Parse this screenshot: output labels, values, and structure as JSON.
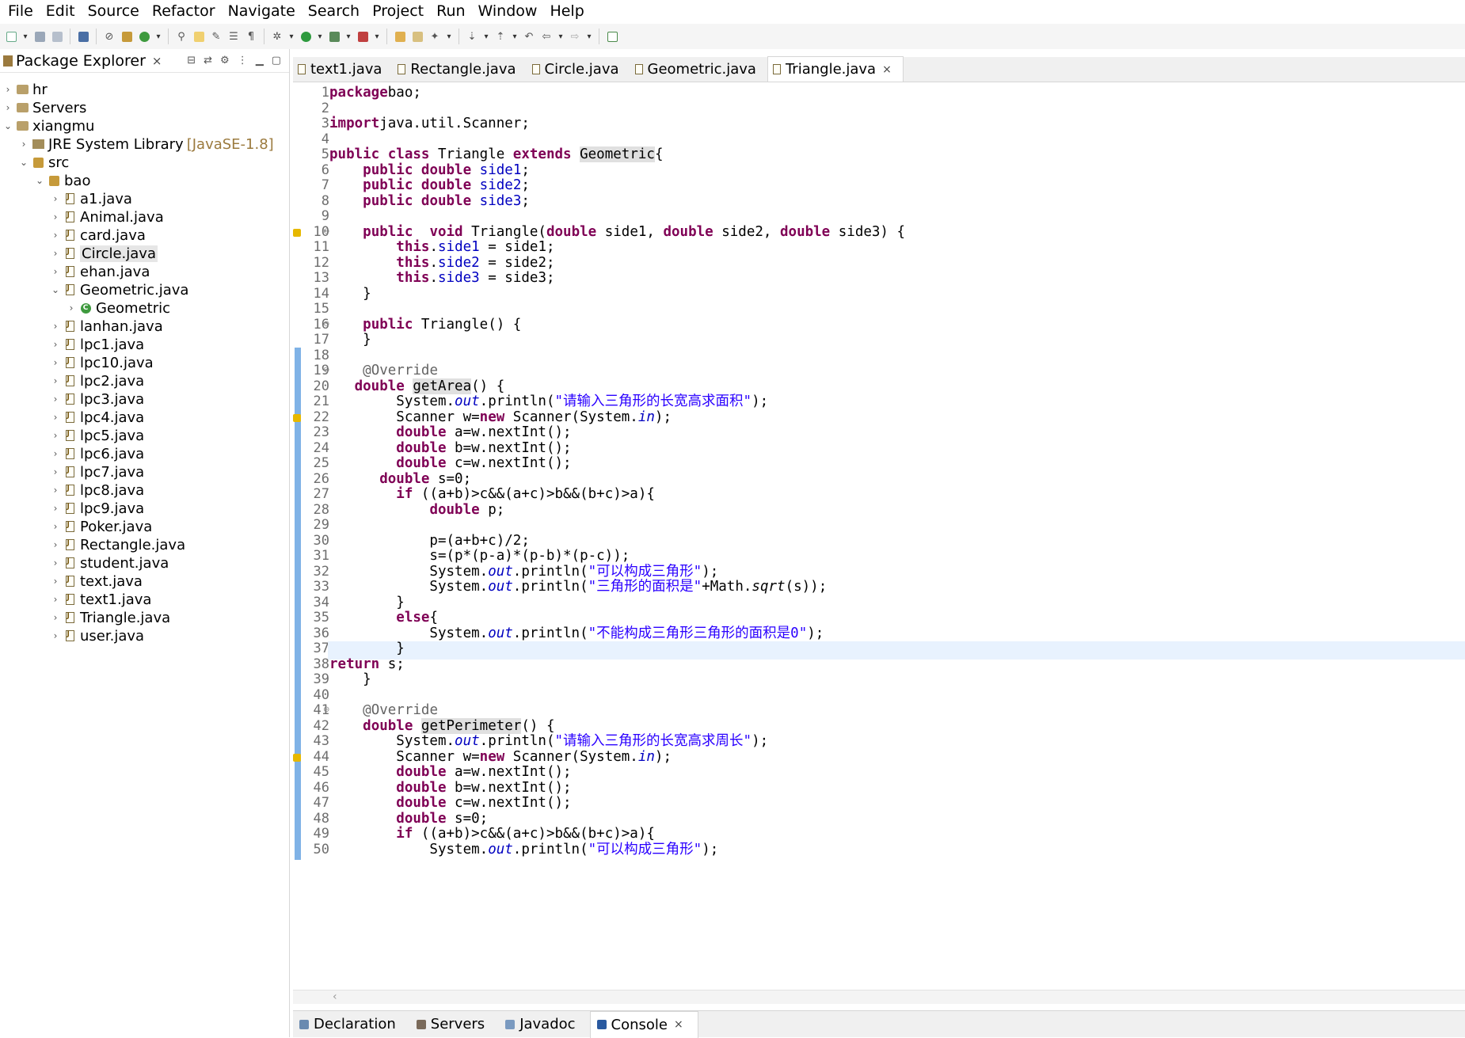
{
  "menu": [
    "File",
    "Edit",
    "Source",
    "Refactor",
    "Navigate",
    "Search",
    "Project",
    "Run",
    "Window",
    "Help"
  ],
  "explorer": {
    "title": "Package Explorer",
    "close": "×",
    "tree": [
      {
        "label": "hr",
        "icon": "project-icon",
        "arrow": "›",
        "indent": 0
      },
      {
        "label": "Servers",
        "icon": "folder-icon",
        "arrow": "›",
        "indent": 0
      },
      {
        "label": "xiangmu",
        "icon": "project-icon",
        "arrow": "⌄",
        "indent": 0
      },
      {
        "label": "JRE System Library",
        "decor": "[JavaSE-1.8]",
        "icon": "library-icon",
        "arrow": "›",
        "indent": 1
      },
      {
        "label": "src",
        "icon": "source-folder-icon",
        "arrow": "⌄",
        "indent": 1
      },
      {
        "label": "bao",
        "icon": "package-icon",
        "arrow": "⌄",
        "indent": 2
      },
      {
        "label": "a1.java",
        "icon": "java-file-icon",
        "arrow": "›",
        "indent": 3
      },
      {
        "label": "Animal.java",
        "icon": "java-file-icon",
        "arrow": "›",
        "indent": 3
      },
      {
        "label": "card.java",
        "icon": "java-file-icon",
        "arrow": "›",
        "indent": 3
      },
      {
        "label": "Circle.java",
        "icon": "java-file-icon",
        "arrow": "›",
        "indent": 3,
        "selected": true
      },
      {
        "label": "ehan.java",
        "icon": "java-file-icon",
        "arrow": "›",
        "indent": 3
      },
      {
        "label": "Geometric.java",
        "icon": "java-file-icon",
        "arrow": "⌄",
        "indent": 3
      },
      {
        "label": "Geometric",
        "icon": "class-icon",
        "arrow": "›",
        "indent": 4
      },
      {
        "label": "lanhan.java",
        "icon": "java-file-icon",
        "arrow": "›",
        "indent": 3
      },
      {
        "label": "lpc1.java",
        "icon": "java-file-icon",
        "arrow": "›",
        "indent": 3
      },
      {
        "label": "lpc10.java",
        "icon": "java-file-icon",
        "arrow": "›",
        "indent": 3
      },
      {
        "label": "lpc2.java",
        "icon": "java-file-icon",
        "arrow": "›",
        "indent": 3
      },
      {
        "label": "lpc3.java",
        "icon": "java-file-icon",
        "arrow": "›",
        "indent": 3
      },
      {
        "label": "lpc4.java",
        "icon": "java-file-icon",
        "arrow": "›",
        "indent": 3
      },
      {
        "label": "lpc5.java",
        "icon": "java-file-icon",
        "arrow": "›",
        "indent": 3
      },
      {
        "label": "lpc6.java",
        "icon": "java-file-icon",
        "arrow": "›",
        "indent": 3
      },
      {
        "label": "lpc7.java",
        "icon": "java-file-icon",
        "arrow": "›",
        "indent": 3
      },
      {
        "label": "lpc8.java",
        "icon": "java-file-icon",
        "arrow": "›",
        "indent": 3
      },
      {
        "label": "lpc9.java",
        "icon": "java-file-icon",
        "arrow": "›",
        "indent": 3
      },
      {
        "label": "Poker.java",
        "icon": "java-file-icon",
        "arrow": "›",
        "indent": 3
      },
      {
        "label": "Rectangle.java",
        "icon": "java-file-icon",
        "arrow": "›",
        "indent": 3
      },
      {
        "label": "student.java",
        "icon": "java-file-icon",
        "arrow": "›",
        "indent": 3
      },
      {
        "label": "text.java",
        "icon": "java-file-icon",
        "arrow": "›",
        "indent": 3
      },
      {
        "label": "text1.java",
        "icon": "java-file-icon",
        "arrow": "›",
        "indent": 3
      },
      {
        "label": "Triangle.java",
        "icon": "java-file-icon",
        "arrow": "›",
        "indent": 3
      },
      {
        "label": "user.java",
        "icon": "java-file-icon",
        "arrow": "›",
        "indent": 3
      }
    ]
  },
  "tabs": [
    {
      "label": "text1.java",
      "active": false
    },
    {
      "label": "Rectangle.java",
      "active": false
    },
    {
      "label": "Circle.java",
      "active": false
    },
    {
      "label": "Geometric.java",
      "active": false
    },
    {
      "label": "Triangle.java",
      "active": true,
      "close": "×"
    }
  ],
  "code": [
    [
      [
        "kw",
        "package"
      ],
      [
        "",
        "bao;"
      ]
    ],
    [],
    [
      [
        "kw",
        "import"
      ],
      [
        "",
        "java.util.Scanner;"
      ]
    ],
    [],
    [
      [
        "kw",
        "public class"
      ],
      [
        "",
        " Triangle "
      ],
      [
        "kw",
        "extends"
      ],
      [
        "",
        " "
      ],
      [
        "hl",
        "Geometric"
      ],
      [
        "",
        "{"
      ]
    ],
    [
      [
        "",
        "    "
      ],
      [
        "kw",
        "public double"
      ],
      [
        "",
        " "
      ],
      [
        "fld",
        "side1"
      ],
      [
        "",
        ";"
      ]
    ],
    [
      [
        "",
        "    "
      ],
      [
        "kw",
        "public double"
      ],
      [
        "",
        " "
      ],
      [
        "fld",
        "side2"
      ],
      [
        "",
        ";"
      ]
    ],
    [
      [
        "",
        "    "
      ],
      [
        "kw",
        "public double"
      ],
      [
        "",
        " "
      ],
      [
        "fld",
        "side3"
      ],
      [
        "",
        ";"
      ]
    ],
    [],
    [
      [
        "",
        "    "
      ],
      [
        "kw",
        "public"
      ],
      [
        "",
        "  "
      ],
      [
        "kw",
        "void"
      ],
      [
        "",
        " Triangle("
      ],
      [
        "kw",
        "double"
      ],
      [
        "",
        " side1, "
      ],
      [
        "kw",
        "double"
      ],
      [
        "",
        " side2, "
      ],
      [
        "kw",
        "double"
      ],
      [
        "",
        " side3) {"
      ]
    ],
    [
      [
        "",
        "        "
      ],
      [
        "kw",
        "this"
      ],
      [
        "",
        "."
      ],
      [
        "fld",
        "side1"
      ],
      [
        "",
        " = side1;"
      ]
    ],
    [
      [
        "",
        "        "
      ],
      [
        "kw",
        "this"
      ],
      [
        "",
        "."
      ],
      [
        "fld",
        "side2"
      ],
      [
        "",
        " = side2;"
      ]
    ],
    [
      [
        "",
        "        "
      ],
      [
        "kw",
        "this"
      ],
      [
        "",
        "."
      ],
      [
        "fld",
        "side3"
      ],
      [
        "",
        " = side3;"
      ]
    ],
    [
      [
        "",
        "    }"
      ]
    ],
    [],
    [
      [
        "",
        "    "
      ],
      [
        "kw",
        "public"
      ],
      [
        "",
        " Triangle() {"
      ]
    ],
    [
      [
        "",
        "    }"
      ]
    ],
    [],
    [
      [
        "",
        "    "
      ],
      [
        "ann",
        "@Override"
      ]
    ],
    [
      [
        "",
        "   "
      ],
      [
        "kw",
        "double"
      ],
      [
        "",
        " "
      ],
      [
        "hl",
        "getArea"
      ],
      [
        "",
        "() {"
      ]
    ],
    [
      [
        "",
        "        System."
      ],
      [
        "fldi",
        "out"
      ],
      [
        "",
        ".println("
      ],
      [
        "str",
        "\"请输入三角形的长宽高求面积\""
      ],
      [
        "",
        ");"
      ]
    ],
    [
      [
        "",
        "        Scanner w="
      ],
      [
        "kw",
        "new"
      ],
      [
        "",
        " Scanner(System."
      ],
      [
        "fldi",
        "in"
      ],
      [
        "",
        ");"
      ]
    ],
    [
      [
        "",
        "        "
      ],
      [
        "kw",
        "double"
      ],
      [
        "",
        " a=w.nextInt();"
      ]
    ],
    [
      [
        "",
        "        "
      ],
      [
        "kw",
        "double"
      ],
      [
        "",
        " b=w.nextInt();"
      ]
    ],
    [
      [
        "",
        "        "
      ],
      [
        "kw",
        "double"
      ],
      [
        "",
        " c=w.nextInt();"
      ]
    ],
    [
      [
        "",
        "      "
      ],
      [
        "kw",
        "double"
      ],
      [
        "",
        " s=0;"
      ]
    ],
    [
      [
        "",
        "        "
      ],
      [
        "kw",
        "if"
      ],
      [
        "",
        " ((a+b)>c&&(a+c)>b&&(b+c)>a){"
      ]
    ],
    [
      [
        "",
        "            "
      ],
      [
        "kw",
        "double"
      ],
      [
        "",
        " p;"
      ]
    ],
    [],
    [
      [
        "",
        "            p=(a+b+c)/2;"
      ]
    ],
    [
      [
        "",
        "            s=(p*(p-a)*(p-b)*(p-c));"
      ]
    ],
    [
      [
        "",
        "            System."
      ],
      [
        "fldi",
        "out"
      ],
      [
        "",
        ".println("
      ],
      [
        "str",
        "\"可以构成三角形\""
      ],
      [
        "",
        ");"
      ]
    ],
    [
      [
        "",
        "            System."
      ],
      [
        "fldi",
        "out"
      ],
      [
        "",
        ".println("
      ],
      [
        "str",
        "\"三角形的面积是\""
      ],
      [
        "",
        "+Math."
      ],
      [
        "ital",
        "sqrt"
      ],
      [
        "",
        "(s));"
      ]
    ],
    [
      [
        "",
        "        }"
      ]
    ],
    [
      [
        "",
        "        "
      ],
      [
        "kw",
        "else"
      ],
      [
        "",
        "{"
      ]
    ],
    [
      [
        "",
        "            System."
      ],
      [
        "fldi",
        "out"
      ],
      [
        "",
        ".println("
      ],
      [
        "str",
        "\"不能构成三角形三角形的面积是0\""
      ],
      [
        "",
        ");"
      ]
    ],
    [
      [
        "",
        "        }"
      ]
    ],
    [
      [
        "kw",
        "return"
      ],
      [
        "",
        " s;"
      ]
    ],
    [
      [
        "",
        "    }"
      ]
    ],
    [],
    [
      [
        "",
        "    "
      ],
      [
        "ann",
        "@Override"
      ]
    ],
    [
      [
        "",
        "    "
      ],
      [
        "kw",
        "double"
      ],
      [
        "",
        " "
      ],
      [
        "hl",
        "getPerimeter"
      ],
      [
        "",
        "() {"
      ]
    ],
    [
      [
        "",
        "        System."
      ],
      [
        "fldi",
        "out"
      ],
      [
        "",
        ".println("
      ],
      [
        "str",
        "\"请输入三角形的长宽高求周长\""
      ],
      [
        "",
        ");"
      ]
    ],
    [
      [
        "",
        "        Scanner w="
      ],
      [
        "kw",
        "new"
      ],
      [
        "",
        " Scanner(System."
      ],
      [
        "fldi",
        "in"
      ],
      [
        "",
        ");"
      ]
    ],
    [
      [
        "",
        "        "
      ],
      [
        "kw",
        "double"
      ],
      [
        "",
        " a=w.nextInt();"
      ]
    ],
    [
      [
        "",
        "        "
      ],
      [
        "kw",
        "double"
      ],
      [
        "",
        " b=w.nextInt();"
      ]
    ],
    [
      [
        "",
        "        "
      ],
      [
        "kw",
        "double"
      ],
      [
        "",
        " c=w.nextInt();"
      ]
    ],
    [
      [
        "",
        "        "
      ],
      [
        "kw",
        "double"
      ],
      [
        "",
        " s=0;"
      ]
    ],
    [
      [
        "",
        "        "
      ],
      [
        "kw",
        "if"
      ],
      [
        "",
        " ((a+b)>c&&(a+c)>b&&(b+c)>a){"
      ]
    ],
    [
      [
        "",
        "            System."
      ],
      [
        "fldi",
        "out"
      ],
      [
        "",
        ".println("
      ],
      [
        "str",
        "\"可以构成三角形\""
      ],
      [
        "",
        ");"
      ]
    ]
  ],
  "current_line": 37,
  "bottom_tabs": [
    {
      "label": "Declaration",
      "active": false
    },
    {
      "label": "Servers",
      "active": false
    },
    {
      "label": "Javadoc",
      "active": false
    },
    {
      "label": "Console",
      "active": true,
      "close": "×"
    }
  ],
  "colors": {
    "keyword": "#7f0055",
    "field": "#0000c0",
    "string": "#2a00ff",
    "annotation": "#646464",
    "current_line": "#e8f2fe",
    "quick_diff": "#7fb2e6"
  }
}
